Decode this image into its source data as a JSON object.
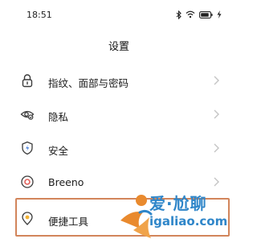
{
  "status_bar": {
    "time": "18:51",
    "icons": [
      "bluetooth-icon",
      "wifi-icon",
      "battery-icon",
      "charging-icon"
    ]
  },
  "header": {
    "title": "设置"
  },
  "settings": {
    "items": [
      {
        "label": "指纹、面部与密码",
        "icon": "lock-icon"
      },
      {
        "label": "隐私",
        "icon": "privacy-eye-icon"
      },
      {
        "label": "安全",
        "icon": "security-shield-icon"
      },
      {
        "label": "Breeno",
        "icon": "breeno-icon"
      },
      {
        "label": "便捷工具",
        "icon": "convenience-tools-icon"
      }
    ]
  },
  "watermark": {
    "brand": "爱·尬聊",
    "url": "igaliao.com"
  },
  "colors": {
    "highlight": "#d2855b",
    "watermark": "#2f86c9",
    "icon": "#3a3a3a",
    "chevron": "#c4c4c4"
  }
}
